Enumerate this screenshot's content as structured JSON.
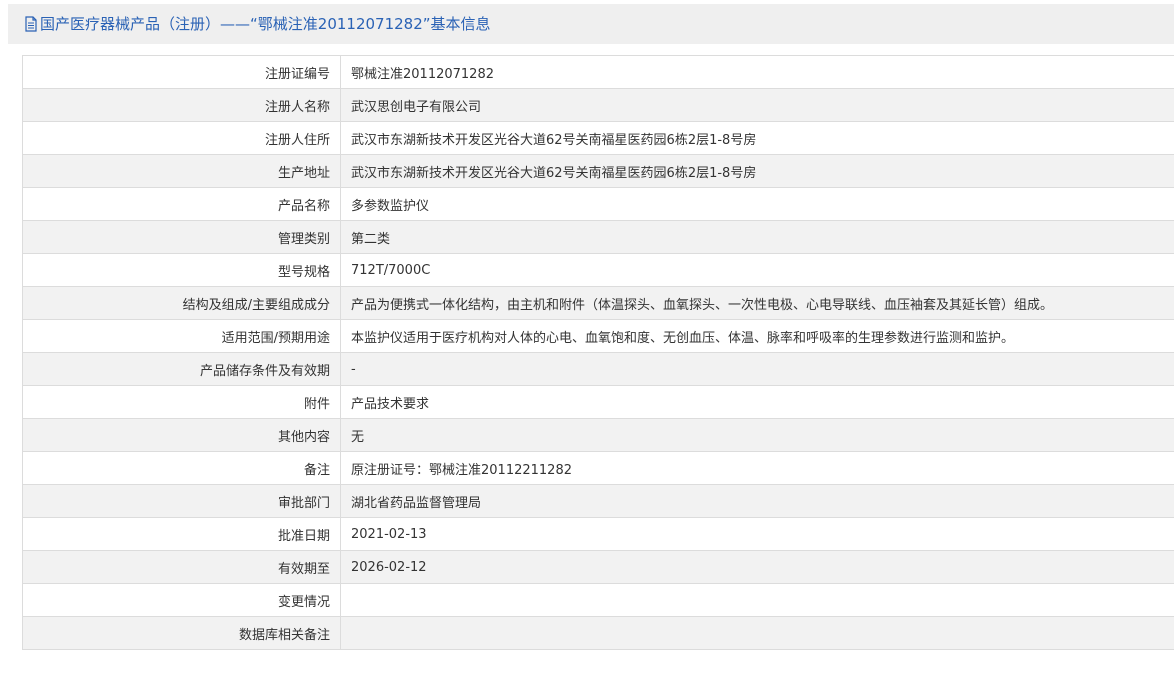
{
  "header": {
    "icon": "document-icon",
    "title": "国产医疗器械产品（注册）——“鄂械注准20112071282”基本信息"
  },
  "rows": [
    {
      "label": "注册证编号",
      "value": "鄂械注准20112071282"
    },
    {
      "label": "注册人名称",
      "value": "武汉思创电子有限公司"
    },
    {
      "label": "注册人住所",
      "value": "武汉市东湖新技术开发区光谷大道62号关南福星医药园6栋2层1-8号房"
    },
    {
      "label": "生产地址",
      "value": "武汉市东湖新技术开发区光谷大道62号关南福星医药园6栋2层1-8号房"
    },
    {
      "label": "产品名称",
      "value": "多参数监护仪"
    },
    {
      "label": "管理类别",
      "value": "第二类"
    },
    {
      "label": "型号规格",
      "value": "712T/7000C"
    },
    {
      "label": "结构及组成/主要组成成分",
      "value": "产品为便携式一体化结构，由主机和附件（体温探头、血氧探头、一次性电极、心电导联线、血压袖套及其延长管）组成。"
    },
    {
      "label": "适用范围/预期用途",
      "value": "本监护仪适用于医疗机构对人体的心电、血氧饱和度、无创血压、体温、脉率和呼吸率的生理参数进行监测和监护。"
    },
    {
      "label": "产品储存条件及有效期",
      "value": "-"
    },
    {
      "label": "附件",
      "value": "产品技术要求"
    },
    {
      "label": "其他内容",
      "value": "无"
    },
    {
      "label": "备注",
      "value": "原注册证号：鄂械注准20112211282"
    },
    {
      "label": "审批部门",
      "value": "湖北省药品监督管理局"
    },
    {
      "label": "批准日期",
      "value": "2021-02-13"
    },
    {
      "label": "有效期至",
      "value": "2026-02-12"
    },
    {
      "label": "变更情况",
      "value": ""
    },
    {
      "label": "数据库相关备注",
      "value": ""
    }
  ]
}
